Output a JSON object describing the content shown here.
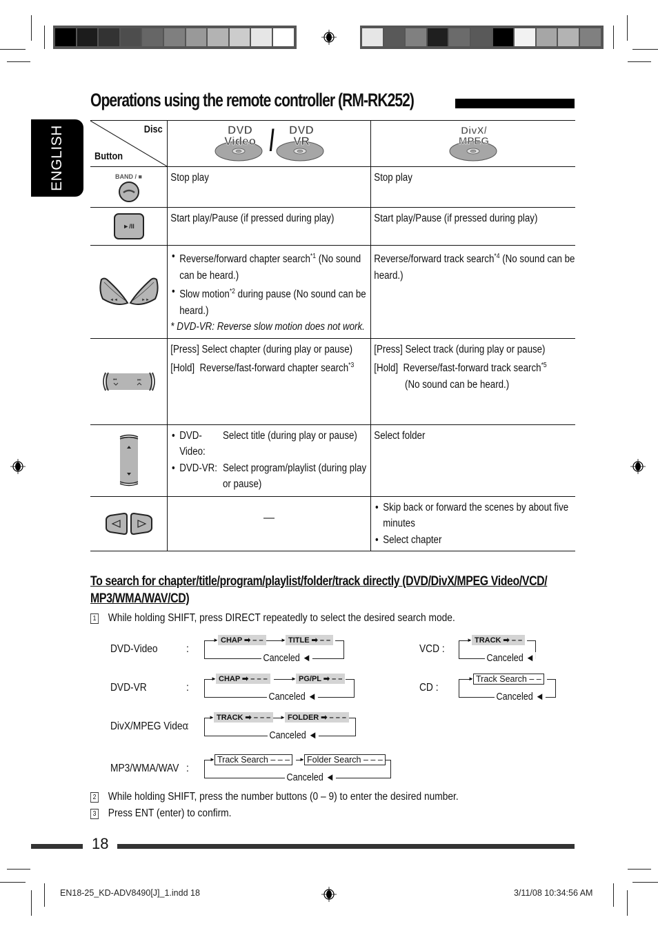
{
  "page": {
    "title": "Operations using the remote controller (RM-RK252)",
    "language_tab": "ENGLISH",
    "page_number": "18"
  },
  "color_bars": {
    "left": [
      "#000000",
      "#1c1c1c",
      "#333333",
      "#4d4d4d",
      "#666666",
      "#7f7f7f",
      "#999999",
      "#b3b3b3",
      "#cccccc",
      "#e6e6e6",
      "#ffffff"
    ],
    "right": [
      "#e6e6e6",
      "#595959",
      "#808080",
      "#1f1f1f",
      "#6b6b6b",
      "#595959",
      "#000000",
      "#f2f2f2",
      "#a6a6a6",
      "#b3b3b3",
      "#808080"
    ]
  },
  "table": {
    "header": {
      "disc_label": "Disc",
      "button_label": "Button",
      "col1_discs": [
        {
          "line1": "DVD",
          "line2": "Video"
        },
        {
          "line1": "DVD",
          "line2": "VR"
        }
      ],
      "col1_separator": "/",
      "col2_disc": {
        "line1": "DivX/",
        "line2": "MPEG"
      }
    },
    "rows": [
      {
        "button": {
          "label": "BAND / ■",
          "icon": "stop-button"
        },
        "col1": "Stop play",
        "col2": "Stop play"
      },
      {
        "button": {
          "label": "►/II",
          "icon": "play-pause-button"
        },
        "col1": "Start play/Pause (if pressed during play)",
        "col2": "Start play/Pause (if pressed during play)"
      },
      {
        "button": {
          "left": "◄◄",
          "right": "►►",
          "icon": "rewind-fast-forward-buttons"
        },
        "col1_items": [
          {
            "text": "Reverse/forward chapter search",
            "sup": "*1",
            "after": " (No sound can be heard.)"
          },
          {
            "text": "Slow motion",
            "sup": "*2",
            "after": " during pause (No sound can be heard.)"
          }
        ],
        "col1_note": "*  DVD-VR: Reverse slow motion does not work.",
        "col2_text": "Reverse/forward track search",
        "col2_sup": "*4",
        "col2_after": " (No sound can be heard.)"
      },
      {
        "button": {
          "icon": "skip-prev-next-buttons"
        },
        "col1_press_key": "[Press]",
        "col1_press": "Select chapter (during play or pause)",
        "col1_hold_key": "[Hold]",
        "col1_hold": "Reverse/fast-forward chapter search",
        "col1_hold_sup": "*3",
        "col2_press_key": "[Press]",
        "col2_press": "Select track (during play or pause)",
        "col2_hold_key": "[Hold]",
        "col2_hold": "Reverse/fast-forward track search",
        "col2_hold_sup": "*5",
        "col2_hold_extra": "(No sound can be heard.)"
      },
      {
        "button": {
          "icon": "up-down-buttons"
        },
        "col1_items": [
          {
            "key": "DVD-Video:",
            "text": "Select title (during play or pause)"
          },
          {
            "key": "DVD-VR:",
            "text": "Select program/playlist (during play or pause)"
          }
        ],
        "col2": "Select folder"
      },
      {
        "button": {
          "icon": "left-right-buttons"
        },
        "col1": "—",
        "col2_items": [
          "Skip back or forward the scenes by about five minutes",
          "Select chapter"
        ]
      }
    ]
  },
  "search_section": {
    "heading": "To search for chapter/title/program/playlist/folder/track directly (DVD/DivX/MPEG Video/VCD/ MP3/WMA/WAV/CD)",
    "steps": [
      {
        "num": "1",
        "text": "While holding SHIFT, press DIRECT repeatedly to select the desired search mode."
      },
      {
        "num": "2",
        "text": "While holding SHIFT, press the number buttons (0 – 9) to enter the desired number."
      },
      {
        "num": "3",
        "text": "Press ENT (enter) to confirm."
      }
    ],
    "modes": [
      {
        "label": "DVD-Video",
        "colon": ":",
        "boxes": [
          "CHAP ➡ – –",
          "TITLE ➡ – –"
        ],
        "style": "gray",
        "canceled": "Canceled"
      },
      {
        "label": "DVD-VR",
        "colon": ":",
        "boxes": [
          "CHAP ➡ – – –",
          "PG/PL ➡ – –"
        ],
        "style": "gray",
        "canceled": "Canceled"
      },
      {
        "label": "DivX/MPEG Video",
        "colon": ":",
        "boxes": [
          "TRACK ➡ – – –",
          "FOLDER ➡ – – –"
        ],
        "style": "gray",
        "canceled": "Canceled"
      },
      {
        "label": "MP3/WMA/WAV",
        "colon": ":",
        "boxes": [
          "Track Search – – –",
          "Folder Search – – –"
        ],
        "style": "white",
        "canceled": "Canceled"
      },
      {
        "label": "VCD :",
        "boxes": [
          "TRACK ➡ – –"
        ],
        "style": "gray",
        "canceled": "Canceled"
      },
      {
        "label": "CD   :",
        "boxes": [
          "Track Search – –"
        ],
        "style": "white",
        "canceled": "Canceled"
      }
    ]
  },
  "footer": {
    "slug_left": "EN18-25_KD-ADV8490[J]_1.indd   18",
    "slug_right": "3/11/08   10:34:56 AM"
  }
}
